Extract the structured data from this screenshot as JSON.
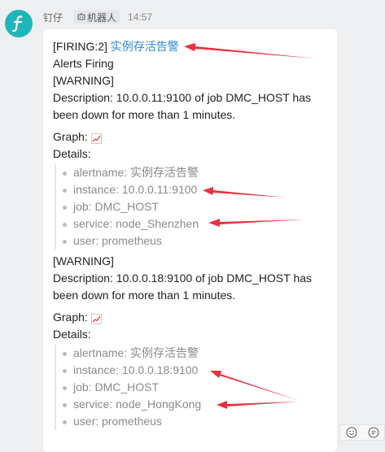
{
  "message": {
    "sender": "钉仔",
    "robot_tag": "机器人",
    "time": "14:57",
    "title_prefix": "[FIRING:2]",
    "title_link": "实例存活告警",
    "alerts_firing": "Alerts Firing",
    "alerts": [
      {
        "level": "[WARNING]",
        "description": "Description: 10.0.0.11:9100 of job DMC_HOST has been down for more than 1 minutes.",
        "graph_label": "Graph:",
        "details_label": "Details:",
        "details": [
          "alertname: 实例存活告警",
          "instance: 10.0.0.11:9100",
          "job: DMC_HOST",
          "service: node_Shenzhen",
          "user: prometheus"
        ]
      },
      {
        "level": "[WARNING]",
        "description": "Description: 10.0.0.18:9100 of job DMC_HOST has been down for more than 1 minutes.",
        "graph_label": "Graph:",
        "details_label": "Details:",
        "details": [
          "alertname: 实例存活告警",
          "instance: 10.0.0.18:9100",
          "job: DMC_HOST",
          "service: node_HongKong",
          "user: prometheus"
        ]
      }
    ]
  },
  "icons": {
    "avatar": "flash-f-icon",
    "robot": "robot-icon",
    "graph": "chart-increasing-icon",
    "reaction_1": "smiley-icon",
    "reaction_2": "comment-icon"
  },
  "colors": {
    "avatar_bg": "#1fb6b9",
    "link": "#2f87e0",
    "annotation_arrow": "#e6323e",
    "detail_text": "#8a8a8a"
  }
}
